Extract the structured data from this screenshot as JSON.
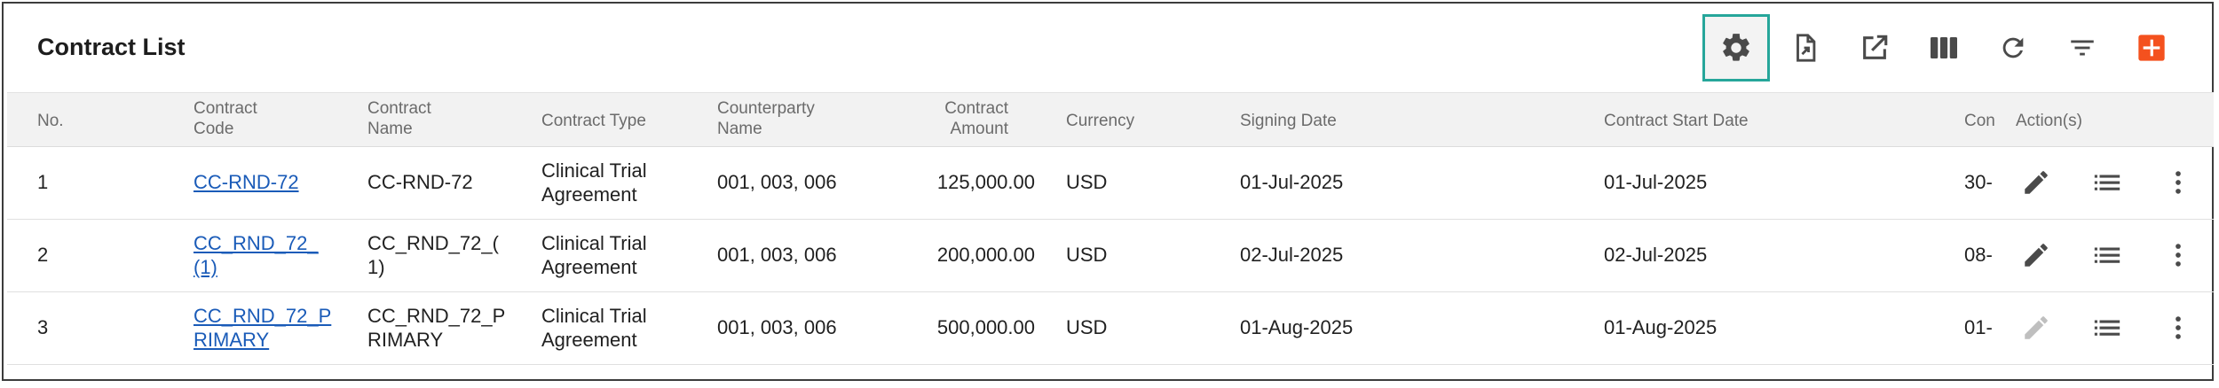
{
  "page": {
    "title": "Contract List"
  },
  "toolbar": {
    "icons": [
      "gear-icon",
      "export-pdf-icon",
      "open-external-icon",
      "columns-icon",
      "refresh-icon",
      "filter-icon",
      "add-icon"
    ],
    "colors": {
      "focus_border": "#26a69a",
      "add_button": "#f4511e",
      "icon": "#4a4a4a"
    }
  },
  "table": {
    "headers": {
      "no": "No.",
      "code_1": "Contract",
      "code_2": "Code",
      "name_1": "Contract",
      "name_2": "Name",
      "type": "Contract Type",
      "cp_1": "Counterparty",
      "cp_2": "Name",
      "amt_1": "Contract",
      "amt_2": "Amount",
      "currency": "Currency",
      "signing": "Signing Date",
      "start": "Contract Start Date",
      "end_clipped": "Con",
      "actions": "Action(s)"
    },
    "rows": [
      {
        "no": "1",
        "code": "CC-RND-72",
        "name_1": "CC-RND-72",
        "name_2": "",
        "type_1": "Clinical Trial",
        "type_2": "Agreement",
        "counterparty": "001, 003, 006",
        "amount": "125,000.00",
        "currency": "USD",
        "signing": "01-Jul-2025",
        "start": "01-Jul-2025",
        "end_clipped": "30-",
        "edit_enabled": true
      },
      {
        "no": "2",
        "code": "CC_RND_72_(1)",
        "name_1": "CC_RND_72_(",
        "name_2": "1)",
        "type_1": "Clinical Trial",
        "type_2": "Agreement",
        "counterparty": "001, 003, 006",
        "amount": "200,000.00",
        "currency": "USD",
        "signing": "02-Jul-2025",
        "start": "02-Jul-2025",
        "end_clipped": "08-",
        "edit_enabled": true
      },
      {
        "no": "3",
        "code": "CC_RND_72_PRIMARY",
        "name_1": "CC_RND_72_P",
        "name_2": "RIMARY",
        "type_1": "Clinical Trial",
        "type_2": "Agreement",
        "counterparty": "001, 003, 006",
        "amount": "500,000.00",
        "currency": "USD",
        "signing": "01-Aug-2025",
        "start": "01-Aug-2025",
        "end_clipped": "01-",
        "edit_enabled": false
      }
    ]
  }
}
